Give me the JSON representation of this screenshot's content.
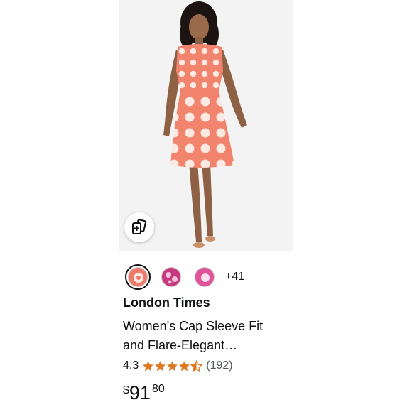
{
  "product": {
    "brand": "London Times",
    "title_line1": "Women's Cap Sleeve Fit",
    "title_line2": "and Flare-Elegant…",
    "rating": "4.3",
    "rating_value": 4.3,
    "review_count": "(192)",
    "price_symbol": "$",
    "price_whole": "91",
    "price_fraction": "80"
  },
  "swatches": {
    "colors": [
      "#f07a6a",
      "#d2468a",
      "#e0559a"
    ],
    "more_label": "+41"
  },
  "icons": {
    "compare": "compare-cards-icon",
    "star": "star-icon"
  },
  "colors": {
    "star": "#de7921",
    "dress": "#f2846e",
    "dots": "#fbe9e2"
  }
}
